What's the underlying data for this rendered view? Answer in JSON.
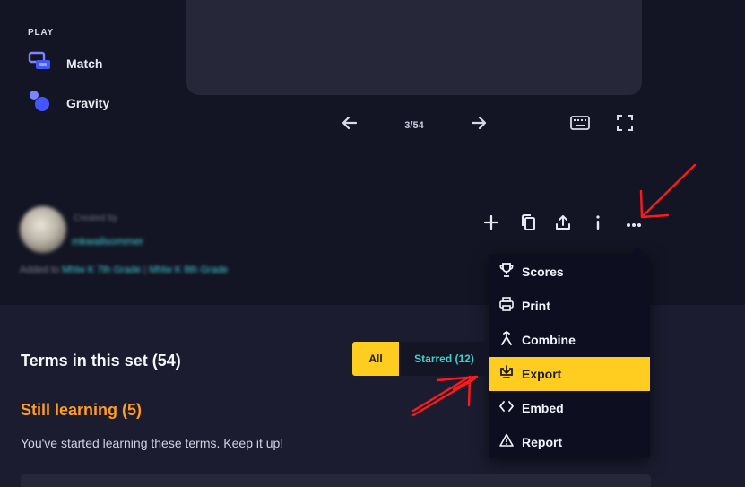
{
  "sidebar": {
    "section_label": "PLAY",
    "items": [
      {
        "label": "Match",
        "icon": "match-icon"
      },
      {
        "label": "Gravity",
        "icon": "gravity-icon"
      }
    ]
  },
  "flashcard": {
    "counter": "3/54",
    "prev_icon": "arrow-left-icon",
    "next_icon": "arrow-right-icon",
    "keyboard_icon": "keyboard-icon",
    "fullscreen_icon": "fullscreen-icon"
  },
  "author": {
    "created_by": "Created by",
    "username": "mkwallsommer",
    "added_to": "Added to",
    "classes": [
      "Mhlw K 7th Grade",
      "Mhlw K 8th Grade"
    ]
  },
  "actions": [
    "add-icon",
    "copy-icon",
    "share-icon",
    "info-icon",
    "more-icon"
  ],
  "menu": {
    "items": [
      {
        "label": "Scores",
        "icon": "trophy-icon",
        "active": false
      },
      {
        "label": "Print",
        "icon": "printer-icon",
        "active": false
      },
      {
        "label": "Combine",
        "icon": "combine-icon",
        "active": false
      },
      {
        "label": "Export",
        "icon": "export-icon",
        "active": true
      },
      {
        "label": "Embed",
        "icon": "code-icon",
        "active": false
      },
      {
        "label": "Report",
        "icon": "warning-icon",
        "active": false
      }
    ]
  },
  "terms": {
    "title": "Terms in this set (54)",
    "filters": {
      "all": "All",
      "starred": "Starred (12)"
    },
    "still_learning": "Still learning (5)",
    "hint": "You've started learning these terms. Keep it up!"
  },
  "colors": {
    "accent_yellow": "#ffcd1f",
    "teal": "#3ccfcf",
    "orange": "#ff9c24",
    "annotation_red": "#ff1a1a"
  }
}
